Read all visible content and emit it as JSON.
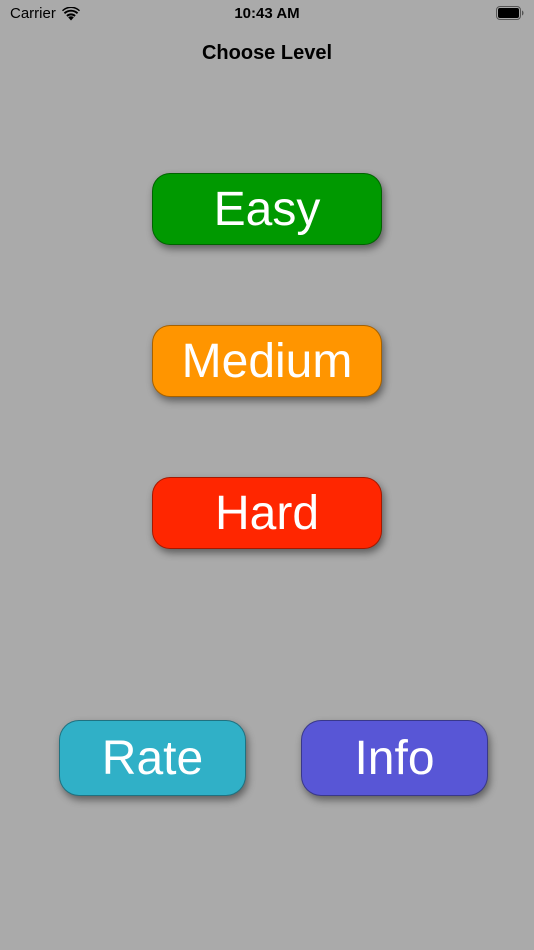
{
  "status_bar": {
    "carrier": "Carrier",
    "time": "10:43 AM",
    "icons": [
      "wifi-icon",
      "battery-icon"
    ]
  },
  "header": {
    "title": "Choose Level"
  },
  "levels": {
    "easy": {
      "label": "Easy",
      "color": "#009900"
    },
    "medium": {
      "label": "Medium",
      "color": "#ff9500"
    },
    "hard": {
      "label": "Hard",
      "color": "#ff2600"
    }
  },
  "footer": {
    "rate": {
      "label": "Rate",
      "color": "#30b0c7"
    },
    "info": {
      "label": "Info",
      "color": "#5856d6"
    }
  },
  "colors": {
    "background": "#aaaaaa",
    "button_text": "#ffffff"
  }
}
